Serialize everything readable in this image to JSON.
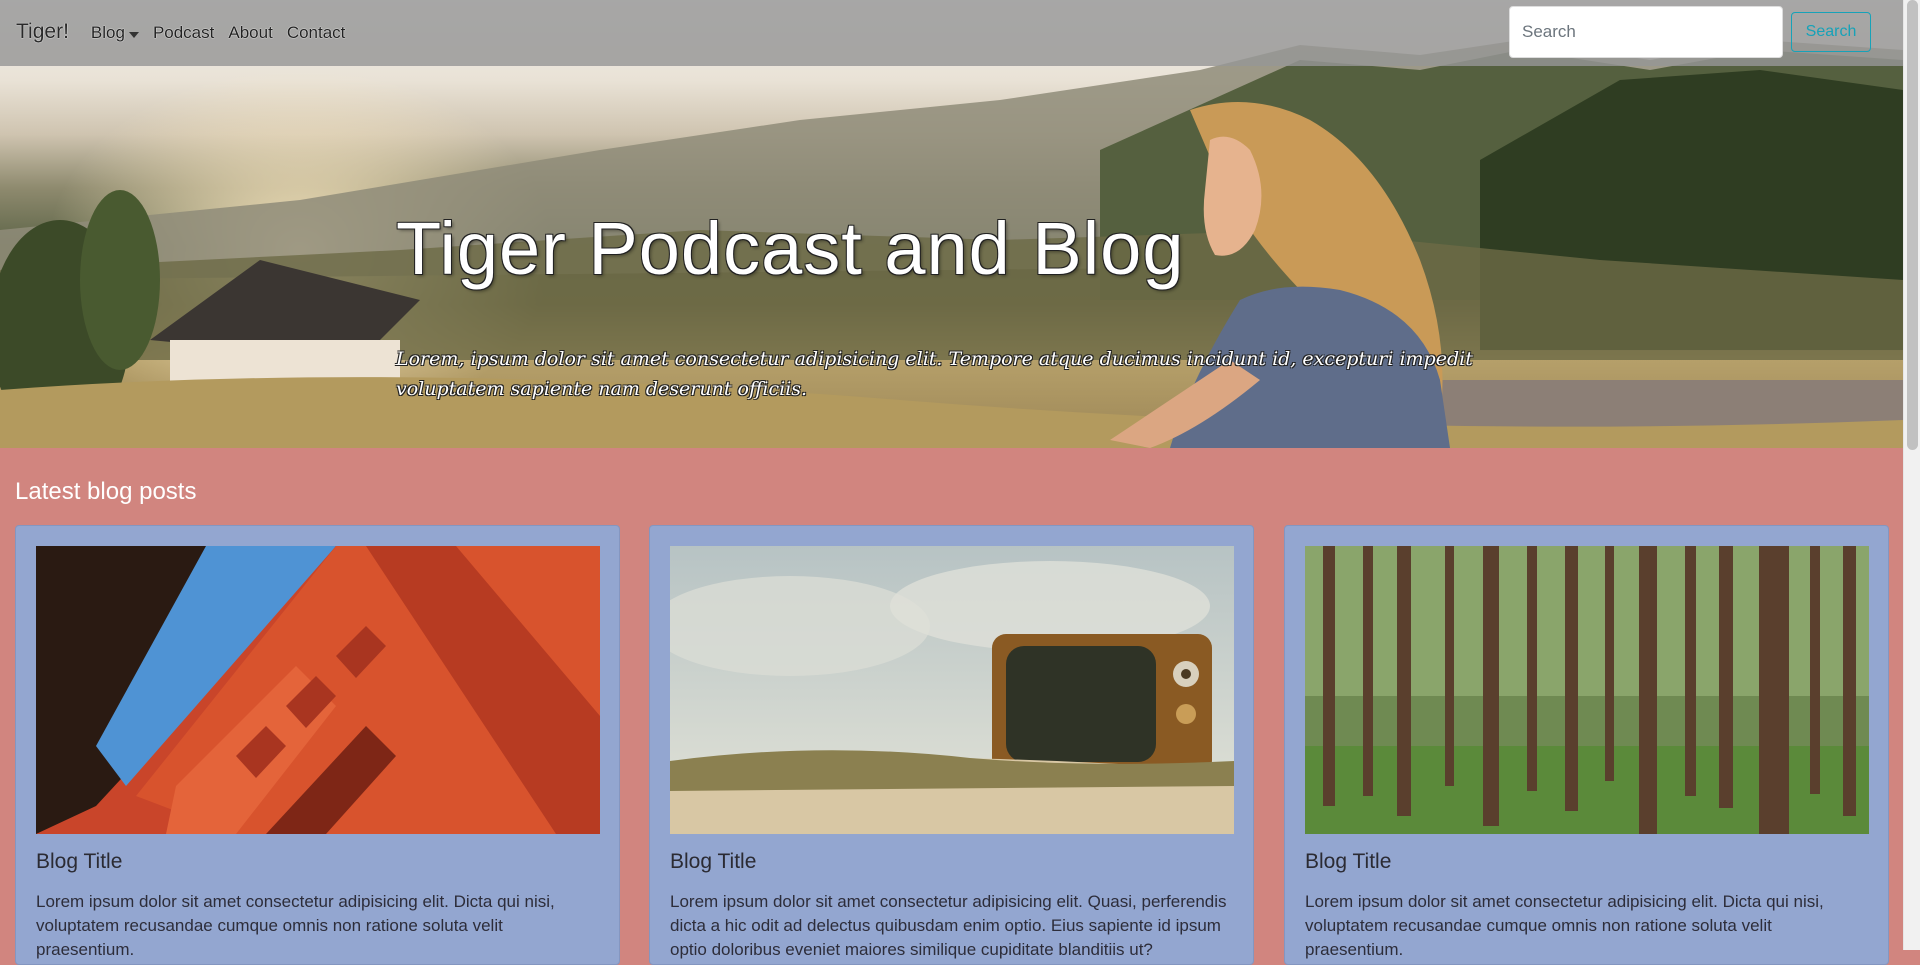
{
  "navbar": {
    "brand": "Tiger!",
    "items": [
      {
        "label": "Blog",
        "has_dropdown": true
      },
      {
        "label": "Podcast"
      },
      {
        "label": "About"
      },
      {
        "label": "Contact"
      }
    ],
    "search": {
      "placeholder": "Search",
      "button_label": "Search"
    }
  },
  "hero": {
    "title": "Tiger Podcast and Blog",
    "subtitle": "Lorem, ipsum dolor sit amet consectetur adipisicing elit. Tempore atque ducimus incidunt id, excepturi impedit voluptatem sapiente nam deserunt officiis."
  },
  "main": {
    "section_title": "Latest blog posts",
    "cards": [
      {
        "title": "Blog Title",
        "text": "Lorem ipsum dolor sit amet consectetur adipisicing elit. Dicta qui nisi, voluptatem recusandae cumque omnis non ratione soluta velit praesentium."
      },
      {
        "title": "Blog Title",
        "text": "Lorem ipsum dolor sit amet consectetur adipisicing elit. Quasi, perferendis dicta a hic odit ad delectus quibusdam enim optio. Eius sapiente id ipsum optio doloribus eveniet maiores similique cupiditate blanditiis ut?"
      },
      {
        "title": "Blog Title",
        "text": "Lorem ipsum dolor sit amet consectetur adipisicing elit. Dicta qui nisi, voluptatem recusandae cumque omnis non ratione soluta velit praesentium."
      }
    ]
  },
  "colors": {
    "navbar_bg": "#969696",
    "content_bg": "#d1857f",
    "card_bg": "#93a6d0",
    "search_button": "#17a2b8"
  }
}
